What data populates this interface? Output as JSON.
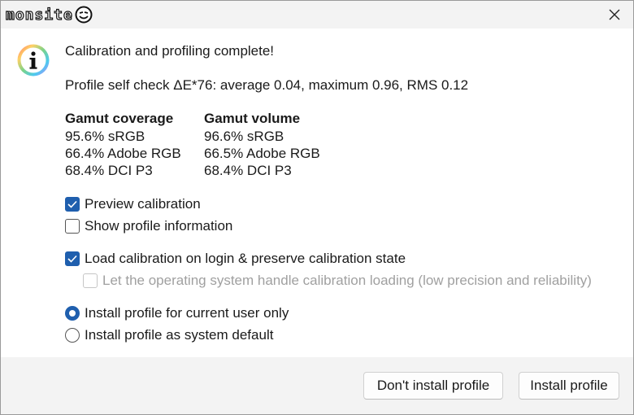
{
  "window": {
    "logo_text": "monsite",
    "close_glyph": "✕"
  },
  "message": {
    "title": "Calibration and profiling complete!",
    "self_check": "Profile self check ΔE*76: average 0.04, maximum 0.96, RMS 0.12"
  },
  "gamut": {
    "coverage_header": "Gamut coverage",
    "volume_header": "Gamut volume",
    "coverage": [
      "95.6% sRGB",
      "66.4% Adobe RGB",
      "68.4% DCI P3"
    ],
    "volume": [
      "96.6% sRGB",
      "66.5% Adobe RGB",
      "68.4% DCI P3"
    ]
  },
  "options": {
    "preview_calibration": {
      "label": "Preview calibration",
      "checked": true
    },
    "show_profile_info": {
      "label": "Show profile information",
      "checked": false
    },
    "load_calibration": {
      "label": "Load calibration on login & preserve calibration state",
      "checked": true
    },
    "os_handle_loading": {
      "label": "Let the operating system handle calibration loading (low precision and reliability)",
      "checked": false,
      "enabled": false
    },
    "install_current_user": {
      "label": "Install profile for current user only",
      "selected": true
    },
    "install_system_default": {
      "label": "Install profile as system default",
      "selected": false
    }
  },
  "buttons": {
    "dont_install": "Don't install profile",
    "install": "Install profile"
  },
  "colors": {
    "accent": "#1f5fae",
    "footer_bg": "#f3f3f3",
    "disabled_text": "#a0a0a0"
  }
}
